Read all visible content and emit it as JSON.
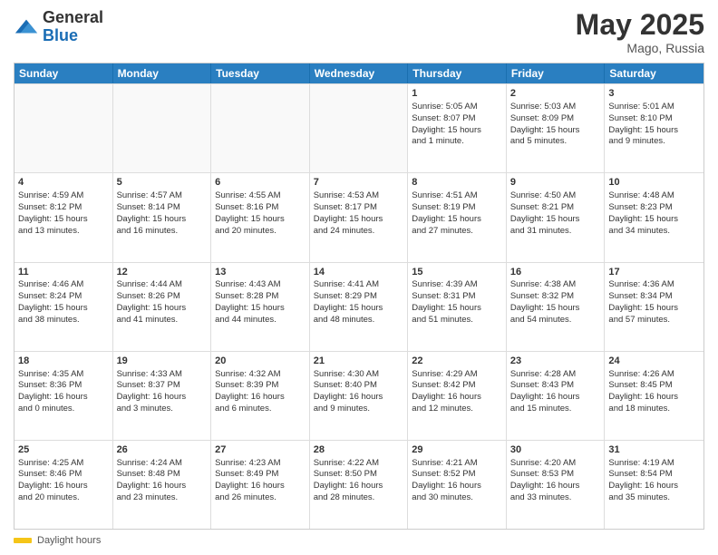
{
  "header": {
    "logo_general": "General",
    "logo_blue": "Blue",
    "month_year": "May 2025",
    "location": "Mago, Russia"
  },
  "days_of_week": [
    "Sunday",
    "Monday",
    "Tuesday",
    "Wednesday",
    "Thursday",
    "Friday",
    "Saturday"
  ],
  "footer": {
    "label": "Daylight hours"
  },
  "weeks": [
    [
      {
        "day": "",
        "empty": true
      },
      {
        "day": "",
        "empty": true
      },
      {
        "day": "",
        "empty": true
      },
      {
        "day": "",
        "empty": true
      },
      {
        "day": "1",
        "line1": "Sunrise: 5:05 AM",
        "line2": "Sunset: 8:07 PM",
        "line3": "Daylight: 15 hours",
        "line4": "and 1 minute."
      },
      {
        "day": "2",
        "line1": "Sunrise: 5:03 AM",
        "line2": "Sunset: 8:09 PM",
        "line3": "Daylight: 15 hours",
        "line4": "and 5 minutes."
      },
      {
        "day": "3",
        "line1": "Sunrise: 5:01 AM",
        "line2": "Sunset: 8:10 PM",
        "line3": "Daylight: 15 hours",
        "line4": "and 9 minutes."
      }
    ],
    [
      {
        "day": "4",
        "line1": "Sunrise: 4:59 AM",
        "line2": "Sunset: 8:12 PM",
        "line3": "Daylight: 15 hours",
        "line4": "and 13 minutes."
      },
      {
        "day": "5",
        "line1": "Sunrise: 4:57 AM",
        "line2": "Sunset: 8:14 PM",
        "line3": "Daylight: 15 hours",
        "line4": "and 16 minutes."
      },
      {
        "day": "6",
        "line1": "Sunrise: 4:55 AM",
        "line2": "Sunset: 8:16 PM",
        "line3": "Daylight: 15 hours",
        "line4": "and 20 minutes."
      },
      {
        "day": "7",
        "line1": "Sunrise: 4:53 AM",
        "line2": "Sunset: 8:17 PM",
        "line3": "Daylight: 15 hours",
        "line4": "and 24 minutes."
      },
      {
        "day": "8",
        "line1": "Sunrise: 4:51 AM",
        "line2": "Sunset: 8:19 PM",
        "line3": "Daylight: 15 hours",
        "line4": "and 27 minutes."
      },
      {
        "day": "9",
        "line1": "Sunrise: 4:50 AM",
        "line2": "Sunset: 8:21 PM",
        "line3": "Daylight: 15 hours",
        "line4": "and 31 minutes."
      },
      {
        "day": "10",
        "line1": "Sunrise: 4:48 AM",
        "line2": "Sunset: 8:23 PM",
        "line3": "Daylight: 15 hours",
        "line4": "and 34 minutes."
      }
    ],
    [
      {
        "day": "11",
        "line1": "Sunrise: 4:46 AM",
        "line2": "Sunset: 8:24 PM",
        "line3": "Daylight: 15 hours",
        "line4": "and 38 minutes."
      },
      {
        "day": "12",
        "line1": "Sunrise: 4:44 AM",
        "line2": "Sunset: 8:26 PM",
        "line3": "Daylight: 15 hours",
        "line4": "and 41 minutes."
      },
      {
        "day": "13",
        "line1": "Sunrise: 4:43 AM",
        "line2": "Sunset: 8:28 PM",
        "line3": "Daylight: 15 hours",
        "line4": "and 44 minutes."
      },
      {
        "day": "14",
        "line1": "Sunrise: 4:41 AM",
        "line2": "Sunset: 8:29 PM",
        "line3": "Daylight: 15 hours",
        "line4": "and 48 minutes."
      },
      {
        "day": "15",
        "line1": "Sunrise: 4:39 AM",
        "line2": "Sunset: 8:31 PM",
        "line3": "Daylight: 15 hours",
        "line4": "and 51 minutes."
      },
      {
        "day": "16",
        "line1": "Sunrise: 4:38 AM",
        "line2": "Sunset: 8:32 PM",
        "line3": "Daylight: 15 hours",
        "line4": "and 54 minutes."
      },
      {
        "day": "17",
        "line1": "Sunrise: 4:36 AM",
        "line2": "Sunset: 8:34 PM",
        "line3": "Daylight: 15 hours",
        "line4": "and 57 minutes."
      }
    ],
    [
      {
        "day": "18",
        "line1": "Sunrise: 4:35 AM",
        "line2": "Sunset: 8:36 PM",
        "line3": "Daylight: 16 hours",
        "line4": "and 0 minutes."
      },
      {
        "day": "19",
        "line1": "Sunrise: 4:33 AM",
        "line2": "Sunset: 8:37 PM",
        "line3": "Daylight: 16 hours",
        "line4": "and 3 minutes."
      },
      {
        "day": "20",
        "line1": "Sunrise: 4:32 AM",
        "line2": "Sunset: 8:39 PM",
        "line3": "Daylight: 16 hours",
        "line4": "and 6 minutes."
      },
      {
        "day": "21",
        "line1": "Sunrise: 4:30 AM",
        "line2": "Sunset: 8:40 PM",
        "line3": "Daylight: 16 hours",
        "line4": "and 9 minutes."
      },
      {
        "day": "22",
        "line1": "Sunrise: 4:29 AM",
        "line2": "Sunset: 8:42 PM",
        "line3": "Daylight: 16 hours",
        "line4": "and 12 minutes."
      },
      {
        "day": "23",
        "line1": "Sunrise: 4:28 AM",
        "line2": "Sunset: 8:43 PM",
        "line3": "Daylight: 16 hours",
        "line4": "and 15 minutes."
      },
      {
        "day": "24",
        "line1": "Sunrise: 4:26 AM",
        "line2": "Sunset: 8:45 PM",
        "line3": "Daylight: 16 hours",
        "line4": "and 18 minutes."
      }
    ],
    [
      {
        "day": "25",
        "line1": "Sunrise: 4:25 AM",
        "line2": "Sunset: 8:46 PM",
        "line3": "Daylight: 16 hours",
        "line4": "and 20 minutes."
      },
      {
        "day": "26",
        "line1": "Sunrise: 4:24 AM",
        "line2": "Sunset: 8:48 PM",
        "line3": "Daylight: 16 hours",
        "line4": "and 23 minutes."
      },
      {
        "day": "27",
        "line1": "Sunrise: 4:23 AM",
        "line2": "Sunset: 8:49 PM",
        "line3": "Daylight: 16 hours",
        "line4": "and 26 minutes."
      },
      {
        "day": "28",
        "line1": "Sunrise: 4:22 AM",
        "line2": "Sunset: 8:50 PM",
        "line3": "Daylight: 16 hours",
        "line4": "and 28 minutes."
      },
      {
        "day": "29",
        "line1": "Sunrise: 4:21 AM",
        "line2": "Sunset: 8:52 PM",
        "line3": "Daylight: 16 hours",
        "line4": "and 30 minutes."
      },
      {
        "day": "30",
        "line1": "Sunrise: 4:20 AM",
        "line2": "Sunset: 8:53 PM",
        "line3": "Daylight: 16 hours",
        "line4": "and 33 minutes."
      },
      {
        "day": "31",
        "line1": "Sunrise: 4:19 AM",
        "line2": "Sunset: 8:54 PM",
        "line3": "Daylight: 16 hours",
        "line4": "and 35 minutes."
      }
    ]
  ]
}
